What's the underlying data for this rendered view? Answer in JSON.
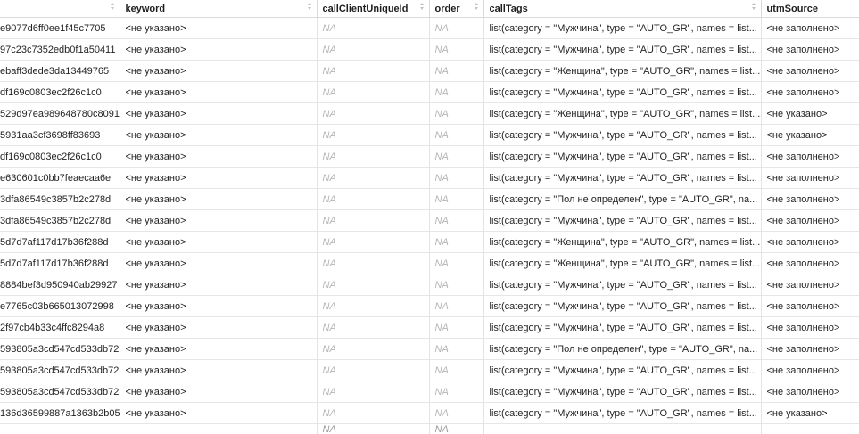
{
  "headers": [
    "",
    "keyword",
    "callClientUniqueId",
    "order",
    "callTags",
    "utmSource"
  ],
  "rows": [
    [
      "e9077d6ff0ee1f45c7705",
      "<не указано>",
      "NA",
      "NA",
      "list(category = \"Мужчина\", type = \"AUTO_GR\", names = list...",
      "<не заполнено>"
    ],
    [
      "97c23c7352edb0f1a50411",
      "<не указано>",
      "NA",
      "NA",
      "list(category = \"Мужчина\", type = \"AUTO_GR\", names = list...",
      "<не заполнено>"
    ],
    [
      "ebaff3dede3da13449765",
      "<не указано>",
      "NA",
      "NA",
      "list(category = \"Женщина\", type = \"AUTO_GR\", names = list...",
      "<не заполнено>"
    ],
    [
      "df169c0803ec2f26c1c0",
      "<не указано>",
      "NA",
      "NA",
      "list(category = \"Мужчина\", type = \"AUTO_GR\", names = list...",
      "<не заполнено>"
    ],
    [
      "529d97ea989648780c8091",
      "<не указано>",
      "NA",
      "NA",
      "list(category = \"Женщина\", type = \"AUTO_GR\", names = list...",
      "<не указано>"
    ],
    [
      "5931aa3cf3698ff83693",
      "<не указано>",
      "NA",
      "NA",
      "list(category = \"Мужчина\", type = \"AUTO_GR\", names = list...",
      "<не указано>"
    ],
    [
      "df169c0803ec2f26c1c0",
      "<не указано>",
      "NA",
      "NA",
      "list(category = \"Мужчина\", type = \"AUTO_GR\", names = list...",
      "<не заполнено>"
    ],
    [
      "e630601c0bb7feaecaa6e",
      "<не указано>",
      "NA",
      "NA",
      "list(category = \"Мужчина\", type = \"AUTO_GR\", names = list...",
      "<не заполнено>"
    ],
    [
      "3dfa86549c3857b2c278d",
      "<не указано>",
      "NA",
      "NA",
      "list(category = \"Пол не определен\", type = \"AUTO_GR\", na...",
      "<не заполнено>"
    ],
    [
      "3dfa86549c3857b2c278d",
      "<не указано>",
      "NA",
      "NA",
      "list(category = \"Мужчина\", type = \"AUTO_GR\", names = list...",
      "<не заполнено>"
    ],
    [
      "5d7d7af117d17b36f288d",
      "<не указано>",
      "NA",
      "NA",
      "list(category = \"Женщина\", type = \"AUTO_GR\", names = list...",
      "<не заполнено>"
    ],
    [
      "5d7d7af117d17b36f288d",
      "<не указано>",
      "NA",
      "NA",
      "list(category = \"Женщина\", type = \"AUTO_GR\", names = list...",
      "<не заполнено>"
    ],
    [
      "8884bef3d950940ab29927",
      "<не указано>",
      "NA",
      "NA",
      "list(category = \"Мужчина\", type = \"AUTO_GR\", names = list...",
      "<не заполнено>"
    ],
    [
      "e7765c03b665013072998",
      "<не указано>",
      "NA",
      "NA",
      "list(category = \"Мужчина\", type = \"AUTO_GR\", names = list...",
      "<не заполнено>"
    ],
    [
      "2f97cb4b33c4ffc8294a8",
      "<не указано>",
      "NA",
      "NA",
      "list(category = \"Мужчина\", type = \"AUTO_GR\", names = list...",
      "<не заполнено>"
    ],
    [
      "593805a3cd547cd533db72",
      "<не указано>",
      "NA",
      "NA",
      "list(category = \"Пол не определен\", type = \"AUTO_GR\", na...",
      "<не заполнено>"
    ],
    [
      "593805a3cd547cd533db72",
      "<не указано>",
      "NA",
      "NA",
      "list(category = \"Мужчина\", type = \"AUTO_GR\", names = list...",
      "<не заполнено>"
    ],
    [
      "593805a3cd547cd533db72",
      "<не указано>",
      "NA",
      "NA",
      "list(category = \"Мужчина\", type = \"AUTO_GR\", names = list...",
      "<не заполнено>"
    ],
    [
      "136d36599887a1363b2b05",
      "<не указано>",
      "NA",
      "NA",
      "list(category = \"Мужчина\", type = \"AUTO_GR\", names = list...",
      "<не указано>"
    ]
  ],
  "partial_row": [
    "",
    "",
    "NA",
    "NA",
    "",
    ""
  ],
  "colors": {
    "na": "#b5b5b5",
    "border": "#e3e3e3"
  }
}
